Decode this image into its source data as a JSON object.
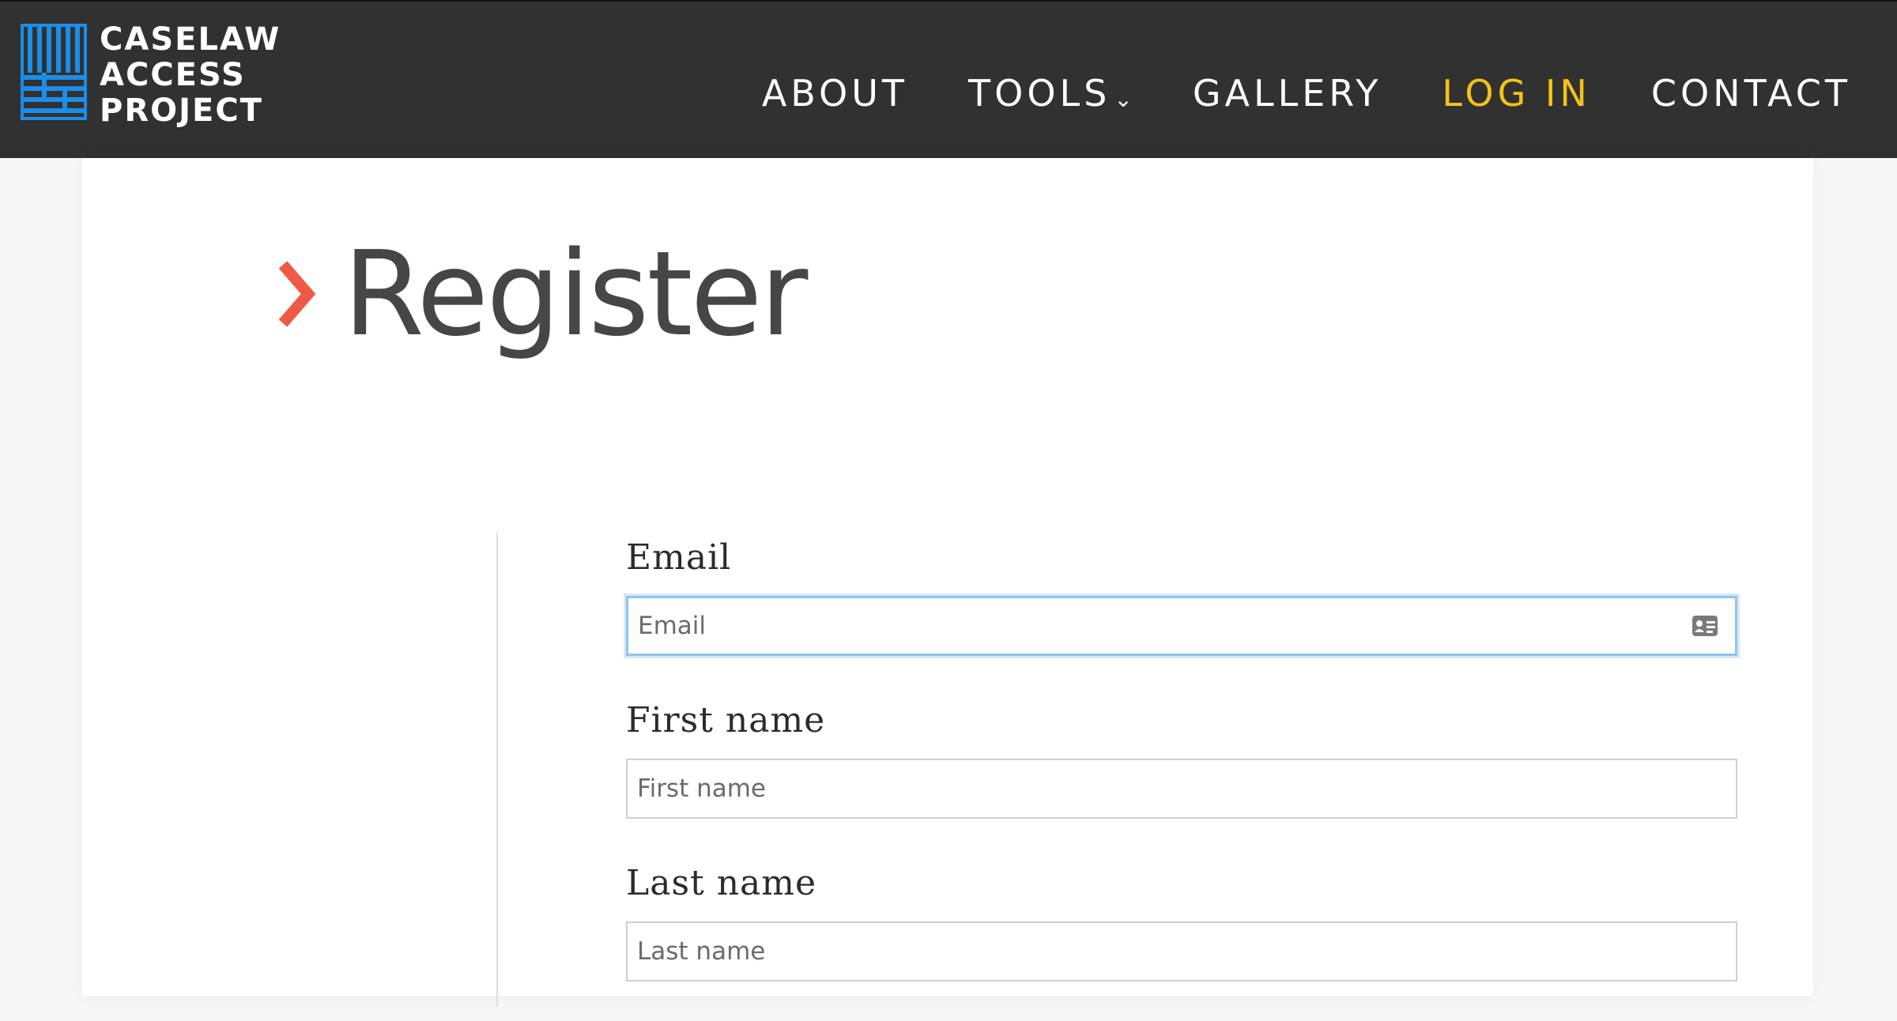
{
  "header": {
    "logo": {
      "lines": [
        "CASELAW",
        "ACCESS",
        "PROJECT"
      ],
      "color": "#1a8ee8"
    },
    "nav": [
      {
        "label": "ABOUT"
      },
      {
        "label": "TOOLS",
        "has_dropdown": true,
        "chevron": "⌄"
      },
      {
        "label": "GALLERY"
      },
      {
        "label": "LOG IN",
        "active": true
      },
      {
        "label": "CONTACT"
      }
    ],
    "background": "#313131",
    "active_color": "#f4c318"
  },
  "main": {
    "title": "Register",
    "title_icon": "chevron-right-diamond-icon",
    "accent_color": "#ef5a45"
  },
  "form": {
    "email": {
      "label": "Email",
      "placeholder": "Email",
      "value": "",
      "icon": "contact-card-icon"
    },
    "first_name": {
      "label": "First name",
      "placeholder": "First name",
      "value": ""
    },
    "last_name": {
      "label": "Last name",
      "placeholder": "Last name",
      "value": ""
    }
  }
}
